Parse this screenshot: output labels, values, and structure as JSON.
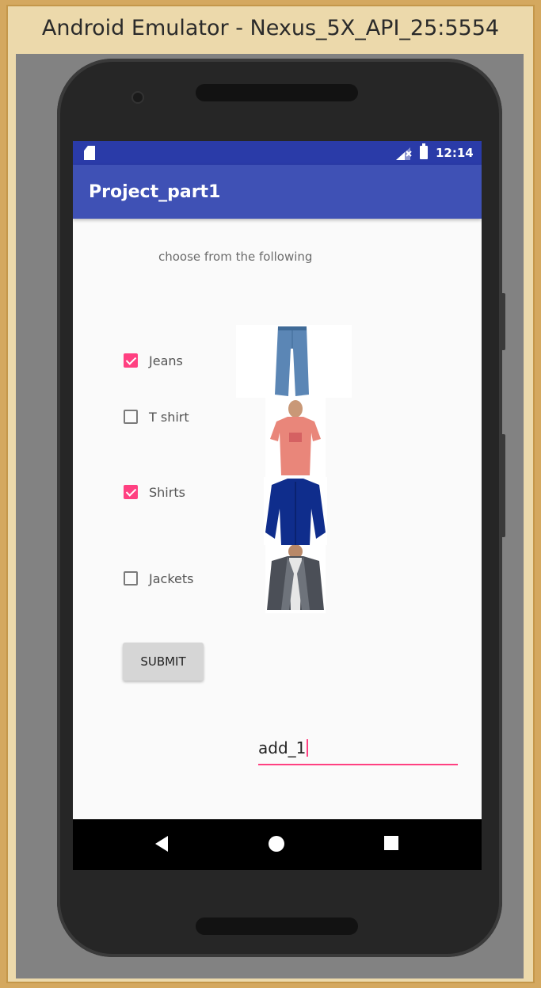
{
  "window": {
    "title": "Android Emulator - Nexus_5X_API_25:5554"
  },
  "status_bar": {
    "time": "12:14"
  },
  "app_bar": {
    "title": "Project_part1"
  },
  "content": {
    "prompt": "choose from the following",
    "options": [
      {
        "label": "Jeans",
        "checked": true,
        "image": "jeans"
      },
      {
        "label": "T shirt",
        "checked": false,
        "image": "t-shirt"
      },
      {
        "label": "Shirts",
        "checked": true,
        "image": "shirt"
      },
      {
        "label": "Jackets",
        "checked": false,
        "image": "jacket"
      }
    ],
    "submit_label": "SUBMIT",
    "input_value": "add_1"
  },
  "colors": {
    "accent": "#ff4081",
    "primary": "#3f51b5",
    "primary_dark": "#2a3ba8"
  },
  "icons": [
    "sd-card-icon",
    "signal-icon",
    "battery-icon",
    "back-icon",
    "home-icon",
    "recents-icon"
  ]
}
